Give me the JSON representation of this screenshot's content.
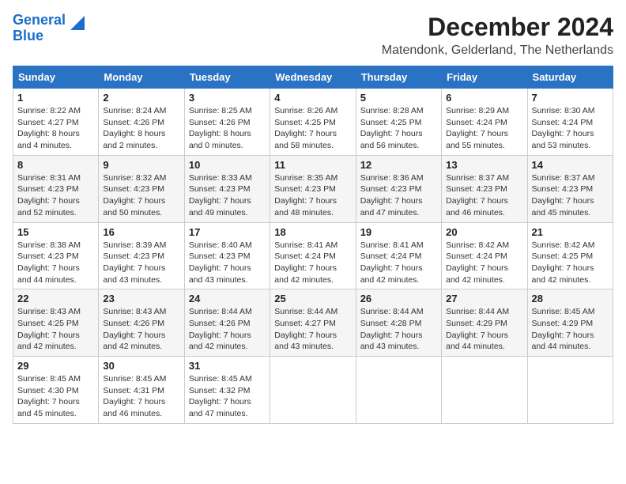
{
  "header": {
    "logo_line1": "General",
    "logo_line2": "Blue",
    "title": "December 2024",
    "subtitle": "Matendonk, Gelderland, The Netherlands"
  },
  "days_of_week": [
    "Sunday",
    "Monday",
    "Tuesday",
    "Wednesday",
    "Thursday",
    "Friday",
    "Saturday"
  ],
  "weeks": [
    [
      {
        "day": "1",
        "info": "Sunrise: 8:22 AM\nSunset: 4:27 PM\nDaylight: 8 hours\nand 4 minutes."
      },
      {
        "day": "2",
        "info": "Sunrise: 8:24 AM\nSunset: 4:26 PM\nDaylight: 8 hours\nand 2 minutes."
      },
      {
        "day": "3",
        "info": "Sunrise: 8:25 AM\nSunset: 4:26 PM\nDaylight: 8 hours\nand 0 minutes."
      },
      {
        "day": "4",
        "info": "Sunrise: 8:26 AM\nSunset: 4:25 PM\nDaylight: 7 hours\nand 58 minutes."
      },
      {
        "day": "5",
        "info": "Sunrise: 8:28 AM\nSunset: 4:25 PM\nDaylight: 7 hours\nand 56 minutes."
      },
      {
        "day": "6",
        "info": "Sunrise: 8:29 AM\nSunset: 4:24 PM\nDaylight: 7 hours\nand 55 minutes."
      },
      {
        "day": "7",
        "info": "Sunrise: 8:30 AM\nSunset: 4:24 PM\nDaylight: 7 hours\nand 53 minutes."
      }
    ],
    [
      {
        "day": "8",
        "info": "Sunrise: 8:31 AM\nSunset: 4:23 PM\nDaylight: 7 hours\nand 52 minutes."
      },
      {
        "day": "9",
        "info": "Sunrise: 8:32 AM\nSunset: 4:23 PM\nDaylight: 7 hours\nand 50 minutes."
      },
      {
        "day": "10",
        "info": "Sunrise: 8:33 AM\nSunset: 4:23 PM\nDaylight: 7 hours\nand 49 minutes."
      },
      {
        "day": "11",
        "info": "Sunrise: 8:35 AM\nSunset: 4:23 PM\nDaylight: 7 hours\nand 48 minutes."
      },
      {
        "day": "12",
        "info": "Sunrise: 8:36 AM\nSunset: 4:23 PM\nDaylight: 7 hours\nand 47 minutes."
      },
      {
        "day": "13",
        "info": "Sunrise: 8:37 AM\nSunset: 4:23 PM\nDaylight: 7 hours\nand 46 minutes."
      },
      {
        "day": "14",
        "info": "Sunrise: 8:37 AM\nSunset: 4:23 PM\nDaylight: 7 hours\nand 45 minutes."
      }
    ],
    [
      {
        "day": "15",
        "info": "Sunrise: 8:38 AM\nSunset: 4:23 PM\nDaylight: 7 hours\nand 44 minutes."
      },
      {
        "day": "16",
        "info": "Sunrise: 8:39 AM\nSunset: 4:23 PM\nDaylight: 7 hours\nand 43 minutes."
      },
      {
        "day": "17",
        "info": "Sunrise: 8:40 AM\nSunset: 4:23 PM\nDaylight: 7 hours\nand 43 minutes."
      },
      {
        "day": "18",
        "info": "Sunrise: 8:41 AM\nSunset: 4:24 PM\nDaylight: 7 hours\nand 42 minutes."
      },
      {
        "day": "19",
        "info": "Sunrise: 8:41 AM\nSunset: 4:24 PM\nDaylight: 7 hours\nand 42 minutes."
      },
      {
        "day": "20",
        "info": "Sunrise: 8:42 AM\nSunset: 4:24 PM\nDaylight: 7 hours\nand 42 minutes."
      },
      {
        "day": "21",
        "info": "Sunrise: 8:42 AM\nSunset: 4:25 PM\nDaylight: 7 hours\nand 42 minutes."
      }
    ],
    [
      {
        "day": "22",
        "info": "Sunrise: 8:43 AM\nSunset: 4:25 PM\nDaylight: 7 hours\nand 42 minutes."
      },
      {
        "day": "23",
        "info": "Sunrise: 8:43 AM\nSunset: 4:26 PM\nDaylight: 7 hours\nand 42 minutes."
      },
      {
        "day": "24",
        "info": "Sunrise: 8:44 AM\nSunset: 4:26 PM\nDaylight: 7 hours\nand 42 minutes."
      },
      {
        "day": "25",
        "info": "Sunrise: 8:44 AM\nSunset: 4:27 PM\nDaylight: 7 hours\nand 43 minutes."
      },
      {
        "day": "26",
        "info": "Sunrise: 8:44 AM\nSunset: 4:28 PM\nDaylight: 7 hours\nand 43 minutes."
      },
      {
        "day": "27",
        "info": "Sunrise: 8:44 AM\nSunset: 4:29 PM\nDaylight: 7 hours\nand 44 minutes."
      },
      {
        "day": "28",
        "info": "Sunrise: 8:45 AM\nSunset: 4:29 PM\nDaylight: 7 hours\nand 44 minutes."
      }
    ],
    [
      {
        "day": "29",
        "info": "Sunrise: 8:45 AM\nSunset: 4:30 PM\nDaylight: 7 hours\nand 45 minutes."
      },
      {
        "day": "30",
        "info": "Sunrise: 8:45 AM\nSunset: 4:31 PM\nDaylight: 7 hours\nand 46 minutes."
      },
      {
        "day": "31",
        "info": "Sunrise: 8:45 AM\nSunset: 4:32 PM\nDaylight: 7 hours\nand 47 minutes."
      },
      {
        "day": "",
        "info": ""
      },
      {
        "day": "",
        "info": ""
      },
      {
        "day": "",
        "info": ""
      },
      {
        "day": "",
        "info": ""
      }
    ]
  ]
}
